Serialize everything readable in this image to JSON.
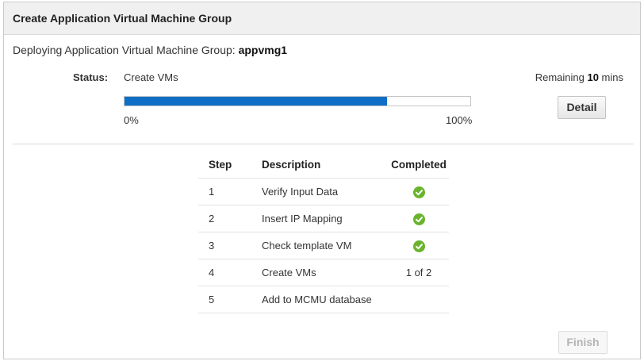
{
  "dialog": {
    "title": "Create Application Virtual Machine Group"
  },
  "deploying": {
    "prefix": "Deploying Application Virtual Machine Group: ",
    "group_name": "appvmg1"
  },
  "status": {
    "label": "Status:",
    "value": "Create VMs",
    "remaining_prefix": "Remaining ",
    "remaining_value": "10",
    "remaining_suffix": " mins"
  },
  "progress": {
    "fraction": 0.76,
    "min_label": "0%",
    "max_label": "100%",
    "color": "#0f6fc6"
  },
  "buttons": {
    "detail": "Detail",
    "finish": "Finish"
  },
  "table": {
    "headers": [
      "Step",
      "Description",
      "Completed"
    ],
    "rows": [
      {
        "step": "1",
        "description": "Verify Input Data",
        "completed": "check-icon"
      },
      {
        "step": "2",
        "description": "Insert IP Mapping",
        "completed": "check-icon"
      },
      {
        "step": "3",
        "description": "Check template VM",
        "completed": "check-icon"
      },
      {
        "step": "4",
        "description": "Create VMs",
        "completed": "1 of 2"
      },
      {
        "step": "5",
        "description": "Add to MCMU database",
        "completed": ""
      }
    ],
    "check_color": "#6ab42d"
  }
}
